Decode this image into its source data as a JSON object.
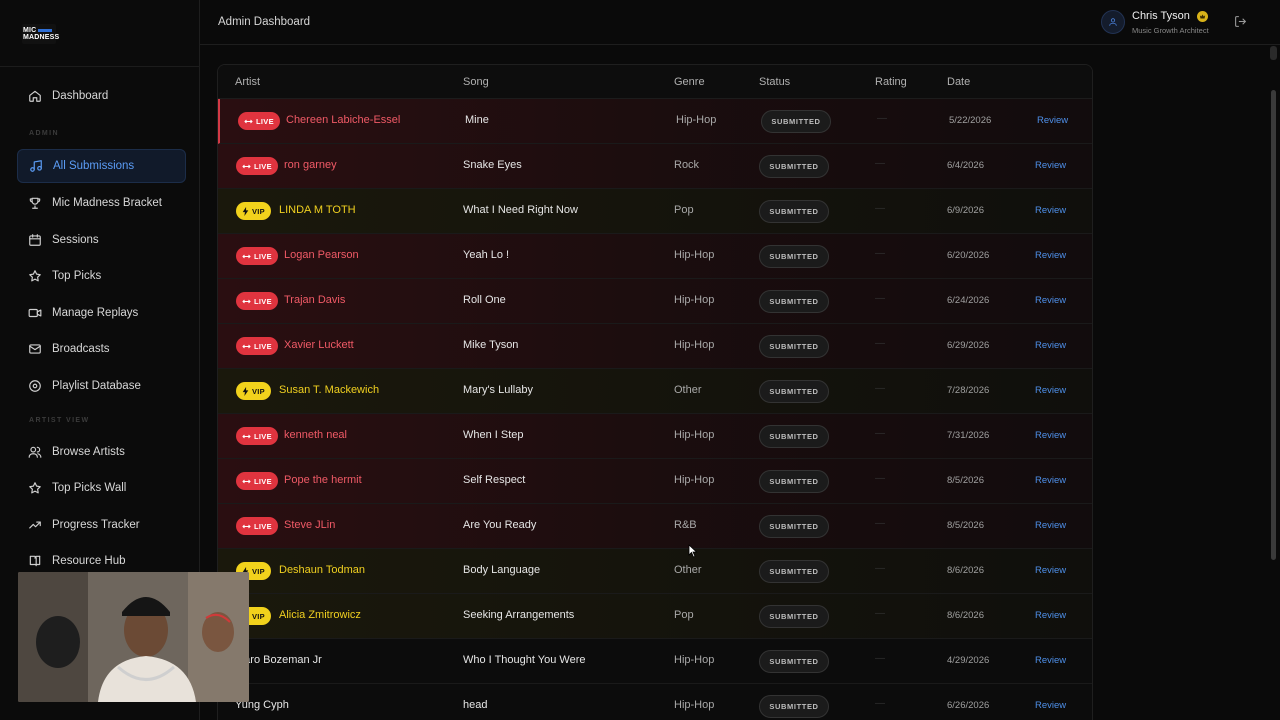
{
  "app": {
    "logo_text": "MIC MADNESS",
    "header_title": "Admin Dashboard"
  },
  "user": {
    "name": "Chris Tyson",
    "role": "Music Growth Architect"
  },
  "sidebar": {
    "items_top": [
      {
        "label": "Dashboard",
        "icon": "home-icon"
      }
    ],
    "admin_section_label": "ADMIN",
    "admin_items": [
      {
        "label": "All Submissions",
        "icon": "music-note-icon",
        "active": true
      },
      {
        "label": "Mic Madness Bracket",
        "icon": "trophy-icon"
      },
      {
        "label": "Sessions",
        "icon": "calendar-icon"
      },
      {
        "label": "Top Picks",
        "icon": "star-icon"
      },
      {
        "label": "Manage Replays",
        "icon": "video-icon"
      },
      {
        "label": "Broadcasts",
        "icon": "mail-icon"
      },
      {
        "label": "Playlist Database",
        "icon": "disc-icon"
      }
    ],
    "artist_section_label": "ARTIST VIEW",
    "artist_items": [
      {
        "label": "Browse Artists",
        "icon": "users-icon"
      },
      {
        "label": "Top Picks Wall",
        "icon": "star-icon"
      },
      {
        "label": "Progress Tracker",
        "icon": "trending-up-icon"
      },
      {
        "label": "Resource Hub",
        "icon": "book-icon"
      }
    ]
  },
  "table": {
    "columns": [
      "Artist",
      "Song",
      "Genre",
      "Status",
      "Rating",
      "Date"
    ],
    "rows": [
      {
        "badge": "LIVE",
        "artist": "Chereen Labiche-Essel",
        "song": "Mine",
        "genre": "Hip-Hop",
        "status": "SUBMITTED",
        "rating": "—",
        "date": "5/22/2026",
        "action": "Review"
      },
      {
        "badge": "LIVE",
        "artist": "ron garney",
        "song": "Snake Eyes",
        "genre": "Rock",
        "status": "SUBMITTED",
        "rating": "—",
        "date": "6/4/2026",
        "action": "Review"
      },
      {
        "badge": "VIP",
        "artist": "LINDA M TOTH",
        "song": "What I Need Right Now",
        "genre": "Pop",
        "status": "SUBMITTED",
        "rating": "—",
        "date": "6/9/2026",
        "action": "Review"
      },
      {
        "badge": "LIVE",
        "artist": "Logan Pearson",
        "song": "Yeah Lo !",
        "genre": "Hip-Hop",
        "status": "SUBMITTED",
        "rating": "—",
        "date": "6/20/2026",
        "action": "Review"
      },
      {
        "badge": "LIVE",
        "artist": "Trajan Davis",
        "song": "Roll One",
        "genre": "Hip-Hop",
        "status": "SUBMITTED",
        "rating": "—",
        "date": "6/24/2026",
        "action": "Review"
      },
      {
        "badge": "LIVE",
        "artist": "Xavier Luckett",
        "song": "Mike Tyson",
        "genre": "Hip-Hop",
        "status": "SUBMITTED",
        "rating": "—",
        "date": "6/29/2026",
        "action": "Review"
      },
      {
        "badge": "VIP",
        "artist": "Susan T. Mackewich",
        "song": "Mary's Lullaby",
        "genre": "Other",
        "status": "SUBMITTED",
        "rating": "—",
        "date": "7/28/2026",
        "action": "Review"
      },
      {
        "badge": "LIVE",
        "artist": "kenneth neal",
        "song": "When I Step",
        "genre": "Hip-Hop",
        "status": "SUBMITTED",
        "rating": "—",
        "date": "7/31/2026",
        "action": "Review"
      },
      {
        "badge": "LIVE",
        "artist": "Pope the hermit",
        "song": "Self Respect",
        "genre": "Hip-Hop",
        "status": "SUBMITTED",
        "rating": "—",
        "date": "8/5/2026",
        "action": "Review"
      },
      {
        "badge": "LIVE",
        "artist": "Steve JLin",
        "song": "Are You Ready",
        "genre": "R&B",
        "status": "SUBMITTED",
        "rating": "—",
        "date": "8/5/2026",
        "action": "Review"
      },
      {
        "badge": "VIP",
        "artist": "Deshaun Todman",
        "song": "Body Language",
        "genre": "Other",
        "status": "SUBMITTED",
        "rating": "—",
        "date": "8/6/2026",
        "action": "Review"
      },
      {
        "badge": "VIP",
        "artist": "Alicia Zmitrowicz",
        "song": "Seeking Arrangements",
        "genre": "Pop",
        "status": "SUBMITTED",
        "rating": "—",
        "date": "8/6/2026",
        "action": "Review"
      },
      {
        "badge": "",
        "artist": "maro Bozeman Jr",
        "song": "Who I Thought You Were",
        "genre": "Hip-Hop",
        "status": "SUBMITTED",
        "rating": "—",
        "date": "4/29/2026",
        "action": "Review"
      },
      {
        "badge": "",
        "artist": "Yung Cyph",
        "song": "head",
        "genre": "Hip-Hop",
        "status": "SUBMITTED",
        "rating": "—",
        "date": "6/26/2026",
        "action": "Review"
      }
    ]
  },
  "colors": {
    "live": "#e0343f",
    "vip": "#f2d21c",
    "accent": "#4e8fe8"
  }
}
